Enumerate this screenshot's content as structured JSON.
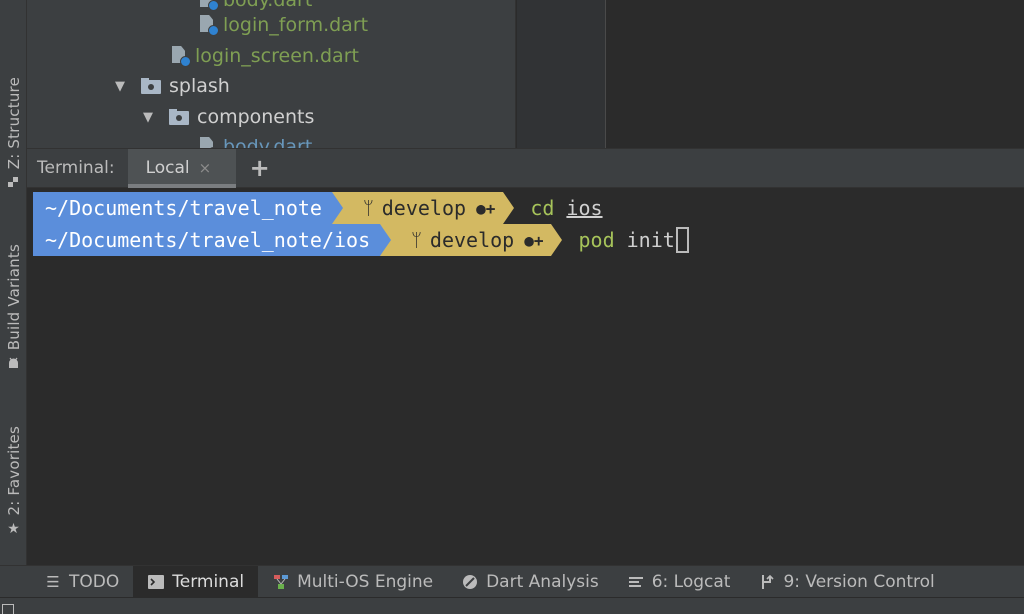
{
  "left_tabs": [
    {
      "label": "Z: Structure",
      "icon": "structure-icon"
    },
    {
      "label": "Build Variants",
      "icon": "android-icon"
    },
    {
      "label": "2: Favorites",
      "icon": "star-icon"
    }
  ],
  "tree": {
    "rows": [
      {
        "label": "body.dart",
        "type": "file",
        "color": "#7f9f53"
      },
      {
        "label": "login_form.dart",
        "type": "file",
        "color": "#7f9f53"
      },
      {
        "label": "login_screen.dart",
        "type": "file",
        "color": "#7f9f53"
      },
      {
        "label": "splash",
        "type": "folder"
      },
      {
        "label": "components",
        "type": "folder"
      },
      {
        "label": "body.dart",
        "type": "file",
        "color": "#6897bb"
      }
    ]
  },
  "terminal": {
    "title": "Terminal:",
    "tab_label": "Local",
    "close_glyph": "×",
    "add_glyph": "+",
    "lines": [
      {
        "path": "~/Documents/travel_note",
        "branch": "develop",
        "command": "cd",
        "argument": "ios"
      },
      {
        "path": "~/Documents/travel_note/ios",
        "branch": "develop",
        "command": "pod",
        "argument": "init"
      }
    ]
  },
  "bottom_tabs": [
    {
      "label": "TODO",
      "icon": "list-icon",
      "active": false
    },
    {
      "label": "Terminal",
      "icon": "terminal-icon",
      "active": true
    },
    {
      "label": "Multi-OS Engine",
      "icon": "multi-os-icon",
      "active": false
    },
    {
      "label": "Dart Analysis",
      "icon": "dart-analysis-icon",
      "active": false
    },
    {
      "label": "6: Logcat",
      "icon": "logcat-icon",
      "active": false
    },
    {
      "label": "9: Version Control",
      "icon": "version-control-icon",
      "active": false
    }
  ],
  "colors": {
    "path_segment": "#5b8edb",
    "git_segment": "#d3b962",
    "command": "#a6c35a"
  }
}
